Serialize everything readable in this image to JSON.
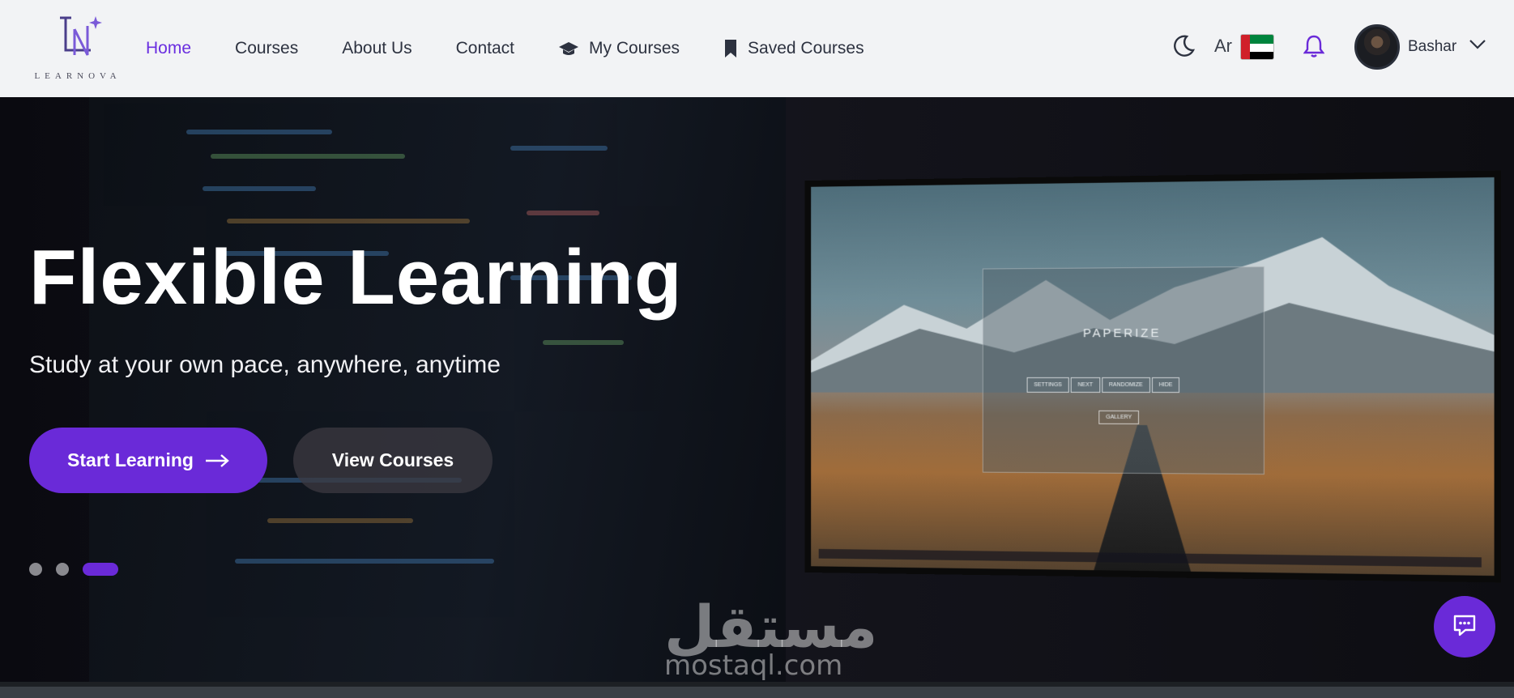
{
  "brand": {
    "logo_letters": "LN",
    "wordmark": "LEARNOVA"
  },
  "nav": {
    "items": [
      {
        "label": "Home",
        "active": true
      },
      {
        "label": "Courses"
      },
      {
        "label": "About Us"
      },
      {
        "label": "Contact"
      },
      {
        "label": "My Courses",
        "icon": "graduation-cap-icon"
      },
      {
        "label": "Saved Courses",
        "icon": "bookmark-icon"
      }
    ],
    "theme_icon": "moon-icon",
    "language": "Ar",
    "notification_icon": "bell-icon",
    "user": {
      "name": "Bashar"
    }
  },
  "hero": {
    "title": "Flexible Learning",
    "subtitle": "Study at your own pace, anywhere, anytime",
    "primary_button": "Start Learning",
    "secondary_button": "View Courses",
    "slides": {
      "count": 3,
      "active": 3
    },
    "screen_text": {
      "app_title": "PAPERIZE",
      "buttons": [
        "SETTINGS",
        "NEXT",
        "RANDOMIZE",
        "HIDE"
      ],
      "gallery": "GALLERY"
    }
  },
  "watermark": {
    "arabic": "مستقل",
    "latin": "mostaql.com"
  },
  "colors": {
    "accent": "#6a2ad8",
    "nav_bg": "#f2f3f5",
    "text_dark": "#2d3240"
  }
}
